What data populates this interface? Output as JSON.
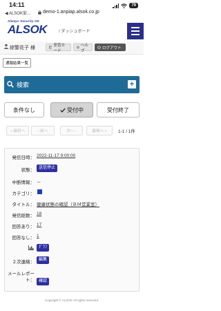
{
  "status_bar": {
    "time": "14:11",
    "back_label": "◀ ALSOK安...",
    "battery": "79",
    "url": "demo-1.anpiap.alsok.co.jp"
  },
  "header": {
    "logo_tagline": "Always Security OK",
    "logo_text": "ALSOK",
    "subtitle": "/ ダッシュボード"
  },
  "user_bar": {
    "user_name": "綜警花子 様",
    "btn_mailbox": "安否カード",
    "btn_help": "ヘルプ",
    "btn_logout": "ログアウト"
  },
  "list_all_label": "通報結果一覧",
  "search": {
    "label": "検索"
  },
  "tabs": [
    {
      "label": "条件なし"
    },
    {
      "label": "受付中"
    },
    {
      "label": "受付終了"
    }
  ],
  "pager": {
    "first": "« 最初へ",
    "prev": "‹ 前へ",
    "next": "次へ ›",
    "last": "最後へ »",
    "count": "1-1 / 1件"
  },
  "card": {
    "send_date_label": "発信日時：",
    "send_date": "2022-11-17 9:00:00",
    "status_label": "状態：",
    "status_badge": "送信停止",
    "interrupt_label": "中断情報：",
    "interrupt_value": "－",
    "category_label": "カテゴリ：",
    "title_label": "タイトル：",
    "title_value": "健康状態の確認（ＢＭ営業室）",
    "total_label": "発信総数：",
    "total_value": "18",
    "answered_label": "回答あり：",
    "answered_value": "17",
    "unanswered_label": "回答なし：",
    "unanswered_value": "1",
    "graph_badge": "ｸﾞﾗﾌ",
    "secondary_label": "２次連絡：",
    "secondary_badge": "編集",
    "mail_report_label": "メールレポー\nト：",
    "mail_report_badge": "確認",
    "category_color": "#1d3cbf"
  },
  "footer": "Copyright © ALSOK All rights reserved."
}
